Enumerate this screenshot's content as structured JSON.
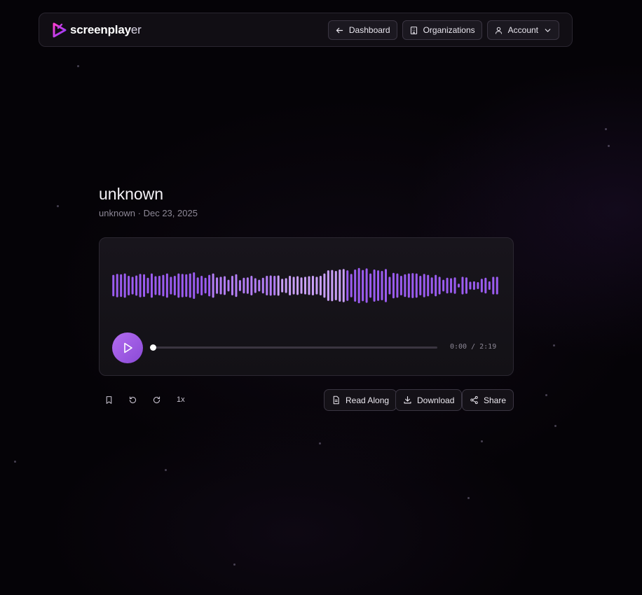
{
  "brand": {
    "name_main": "screenplay",
    "name_tail": "er",
    "accent_color": "#c13cff"
  },
  "nav": {
    "dashboard": {
      "label": "Dashboard",
      "icon": "arrow-left-icon"
    },
    "organizations": {
      "label": "Organizations",
      "icon": "building-icon"
    },
    "account": {
      "label": "Account",
      "icon": "user-icon"
    }
  },
  "recording": {
    "title": "unknown",
    "meta": "unknown · Dec 23, 2025"
  },
  "player": {
    "time": "0:00 / 2:19",
    "progress": 0,
    "wave_color": "#9b5cf0",
    "waveform": [
      0.55,
      0.6,
      0.58,
      0.62,
      0.5,
      0.45,
      0.52,
      0.6,
      0.58,
      0.4,
      0.62,
      0.48,
      0.5,
      0.55,
      0.62,
      0.45,
      0.5,
      0.62,
      0.6,
      0.58,
      0.62,
      0.68,
      0.42,
      0.5,
      0.4,
      0.55,
      0.62,
      0.42,
      0.45,
      0.48,
      0.3,
      0.5,
      0.58,
      0.28,
      0.4,
      0.42,
      0.5,
      0.38,
      0.3,
      0.4,
      0.5,
      0.52,
      0.5,
      0.52,
      0.35,
      0.38,
      0.5,
      0.45,
      0.48,
      0.42,
      0.45,
      0.48,
      0.5,
      0.45,
      0.5,
      0.62,
      0.78,
      0.8,
      0.75,
      0.82,
      0.85,
      0.78,
      0.6,
      0.82,
      0.9,
      0.8,
      0.88,
      0.62,
      0.82,
      0.78,
      0.75,
      0.85,
      0.45,
      0.65,
      0.62,
      0.5,
      0.58,
      0.62,
      0.64,
      0.62,
      0.5,
      0.6,
      0.55,
      0.42,
      0.55,
      0.45,
      0.3,
      0.4,
      0.38,
      0.42,
      0.1,
      0.45,
      0.42,
      0.2,
      0.22,
      0.18,
      0.35,
      0.4,
      0.22,
      0.45,
      0.45
    ]
  },
  "controls": {
    "speed": "1x",
    "read_along": "Read Along",
    "download": "Download",
    "share": "Share"
  }
}
